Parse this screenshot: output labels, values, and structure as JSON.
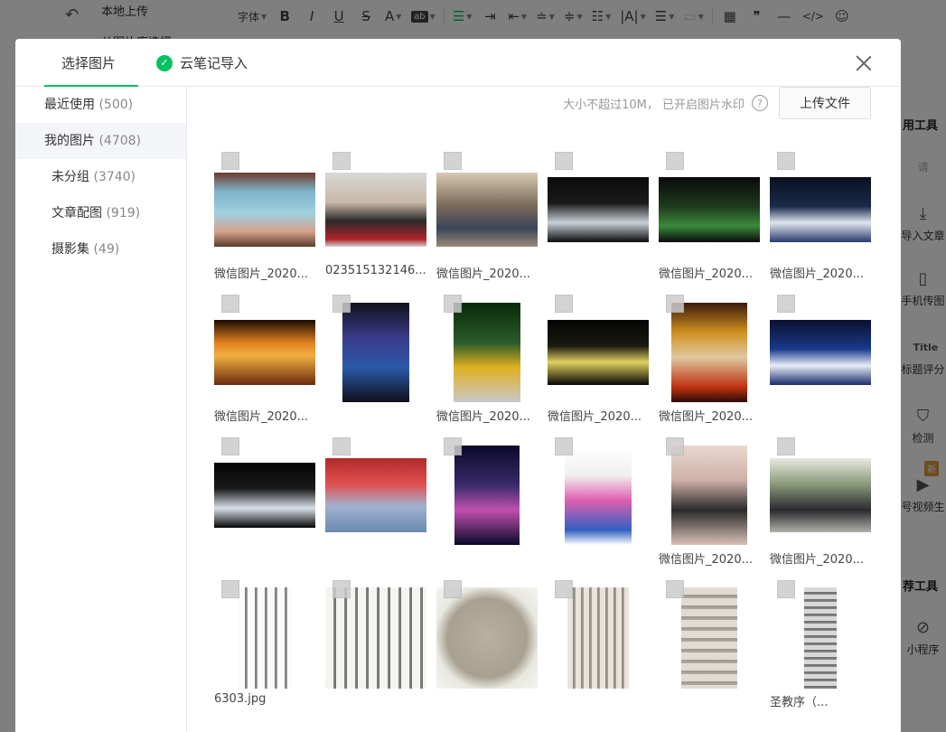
{
  "background": {
    "menu_upload_local": "本地上传",
    "menu_from_library": "从图片库选择",
    "toolbar": {
      "font_label": "字体",
      "bold": "B",
      "italic": "I",
      "underline": "U",
      "strike": "S",
      "font_color": "A",
      "bg_color": "ab"
    },
    "right_panel": {
      "tools_title": "用工具",
      "search_placeholder": "请",
      "import_article": "导入文章",
      "phone_upload": "手机传图",
      "title_score": "标题评分",
      "title_icon_text": "Title",
      "check": "检测",
      "new_badge": "新",
      "video": "号视频生",
      "more_tools_title": "荐工具",
      "miniprogram": "小程序"
    }
  },
  "dialog": {
    "tabs": [
      {
        "label": "选择图片",
        "active": true
      },
      {
        "label": "云笔记导入",
        "active": false
      }
    ],
    "accent_color": "#07c160",
    "sidebar": [
      {
        "label": "最近使用",
        "count": "(500)",
        "sub": false,
        "active": false
      },
      {
        "label": "我的图片",
        "count": "(4708)",
        "sub": false,
        "active": true
      },
      {
        "label": "未分组",
        "count": "(3740)",
        "sub": true,
        "active": false
      },
      {
        "label": "文章配图",
        "count": "(919)",
        "sub": true,
        "active": false
      },
      {
        "label": "摄影集",
        "count": "(49)",
        "sub": true,
        "active": false
      }
    ],
    "upload_hint": "大小不超过10M， 已开启图片水印",
    "upload_button": "上传文件",
    "images": [
      {
        "caption": "微信图片_2020...",
        "kind": "slide"
      },
      {
        "caption": "023515132146...",
        "kind": "portrait"
      },
      {
        "caption": "微信图片_2020...",
        "kind": "room"
      },
      {
        "caption": "",
        "kind": "stage-dark"
      },
      {
        "caption": "微信图片_2020...",
        "kind": "stage-green"
      },
      {
        "caption": "微信图片_2020...",
        "kind": "stage-blue"
      },
      {
        "caption": "微信图片_2020...",
        "kind": "stage-orange"
      },
      {
        "caption": "",
        "kind": "opera-blue"
      },
      {
        "caption": "微信图片_2020...",
        "kind": "opera-green"
      },
      {
        "caption": "微信图片_2020...",
        "kind": "opera-yellow"
      },
      {
        "caption": "微信图片_2020...",
        "kind": "poster"
      },
      {
        "caption": "",
        "kind": "stage-blue2"
      },
      {
        "caption": "",
        "kind": "opera-white"
      },
      {
        "caption": "",
        "kind": "group-stage"
      },
      {
        "caption": "",
        "kind": "opera-purple"
      },
      {
        "caption": "",
        "kind": "opera-pink"
      },
      {
        "caption": "微信图片_2020...",
        "kind": "fan-lady"
      },
      {
        "caption": "微信图片_2020...",
        "kind": "group-photo"
      },
      {
        "caption": "6303.jpg",
        "kind": "calligraphy-tall"
      },
      {
        "caption": "",
        "kind": "calligraphy-wide"
      },
      {
        "caption": "",
        "kind": "calligraphy-round"
      },
      {
        "caption": "",
        "kind": "calligraphy-tall2"
      },
      {
        "caption": "",
        "kind": "calligraphy-tall3"
      },
      {
        "caption": "圣教序（...",
        "kind": "calligraphy-narrow"
      }
    ]
  }
}
